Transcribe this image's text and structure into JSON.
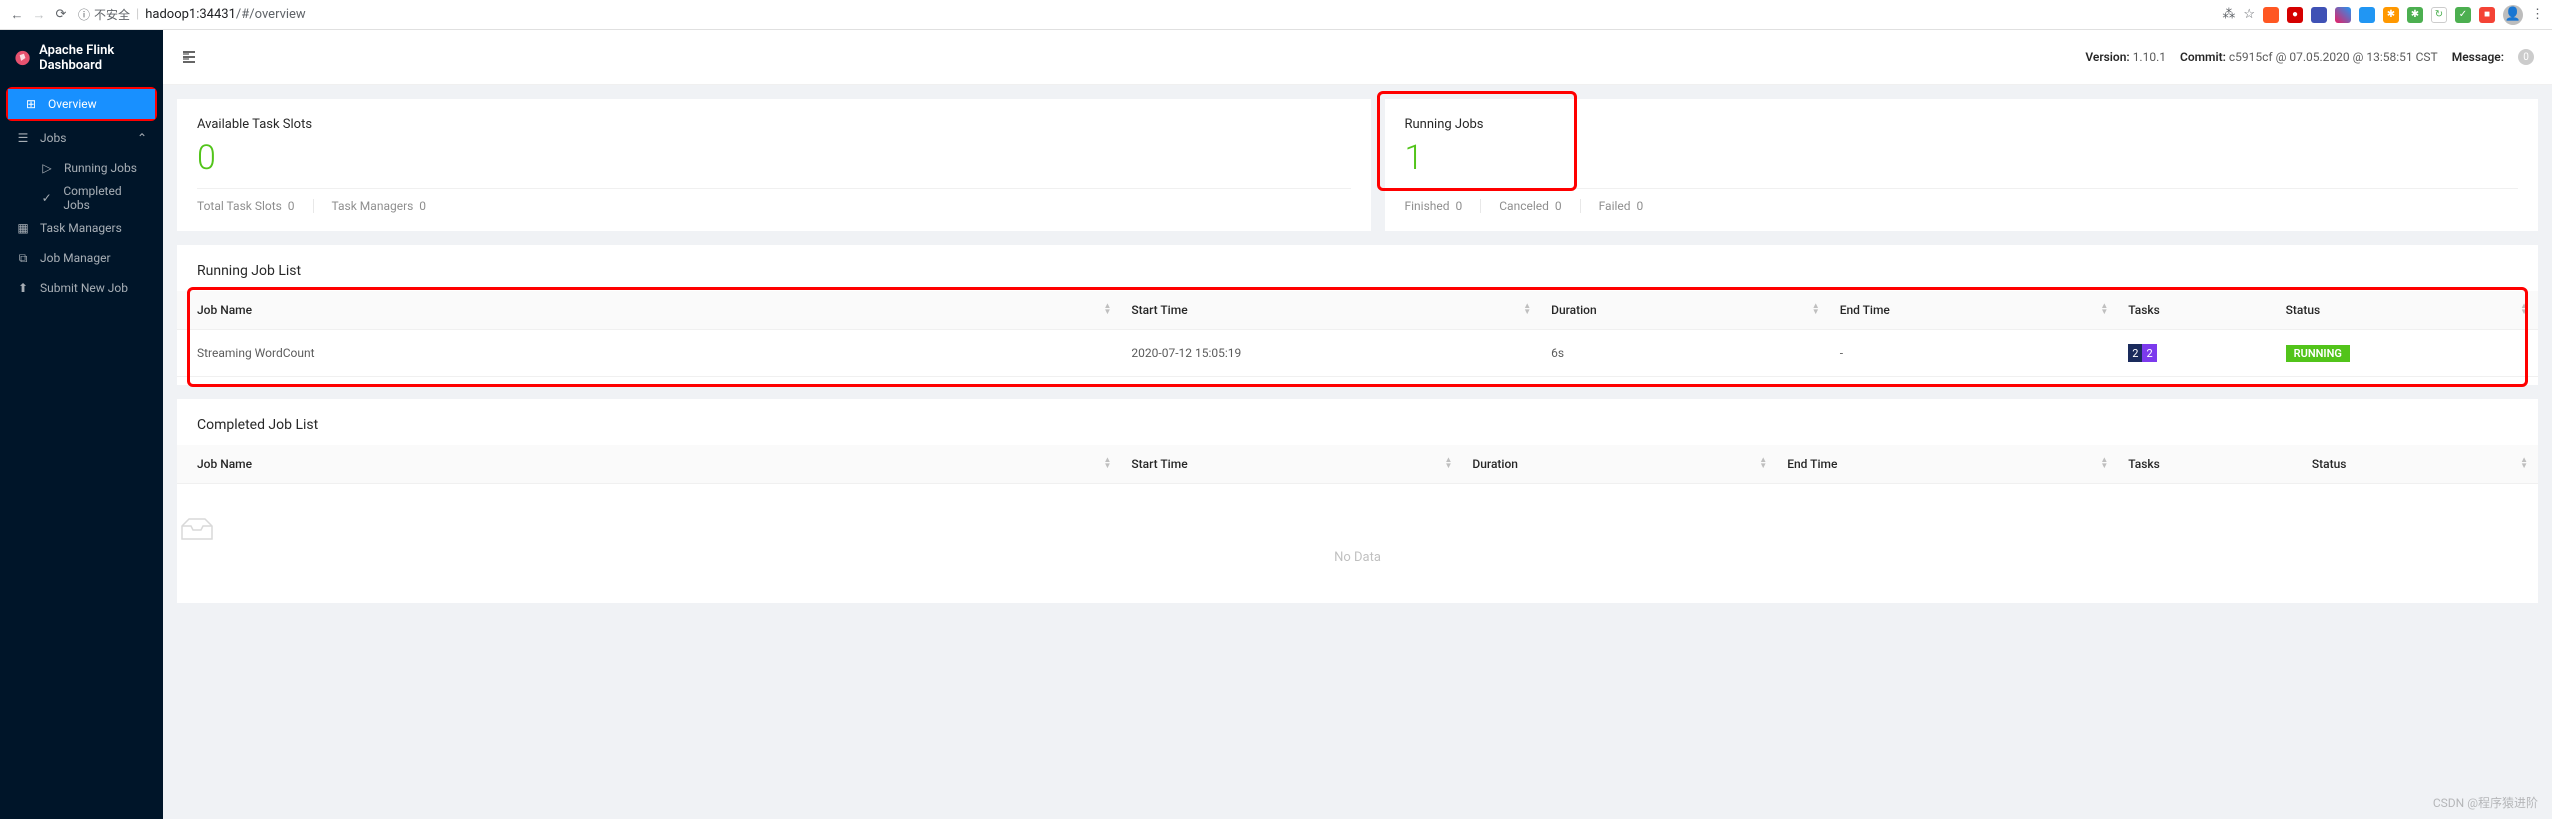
{
  "browser": {
    "url_security": "不安全",
    "url_host": "hadoop1:34431",
    "url_path": "/#/overview"
  },
  "brand": "Apache Flink Dashboard",
  "nav": {
    "overview": "Overview",
    "jobs": "Jobs",
    "running_jobs": "Running Jobs",
    "completed_jobs": "Completed Jobs",
    "task_managers": "Task Managers",
    "job_manager": "Job Manager",
    "submit_new_job": "Submit New Job"
  },
  "topbar": {
    "version_label": "Version:",
    "version_value": "1.10.1",
    "commit_label": "Commit:",
    "commit_value": "c5915cf @ 07.05.2020 @ 13:58:51 CST",
    "message_label": "Message:",
    "message_count": "0"
  },
  "stats": {
    "available_slots": {
      "title": "Available Task Slots",
      "value": "0",
      "total_slots_label": "Total Task Slots",
      "total_slots": "0",
      "tm_label": "Task Managers",
      "tm": "0"
    },
    "running_jobs": {
      "title": "Running Jobs",
      "value": "1",
      "finished_label": "Finished",
      "finished": "0",
      "canceled_label": "Canceled",
      "canceled": "0",
      "failed_label": "Failed",
      "failed": "0"
    }
  },
  "running_list": {
    "title": "Running Job List",
    "columns": {
      "job_name": "Job Name",
      "start_time": "Start Time",
      "duration": "Duration",
      "end_time": "End Time",
      "tasks": "Tasks",
      "status": "Status"
    },
    "rows": [
      {
        "job_name": "Streaming WordCount",
        "start_time": "2020-07-12 15:05:19",
        "duration": "6s",
        "end_time": "-",
        "task_a": "2",
        "task_b": "2",
        "status": "RUNNING"
      }
    ]
  },
  "completed_list": {
    "title": "Completed Job List",
    "columns": {
      "job_name": "Job Name",
      "start_time": "Start Time",
      "duration": "Duration",
      "end_time": "End Time",
      "tasks": "Tasks",
      "status": "Status"
    },
    "no_data": "No Data"
  },
  "watermark": "CSDN @程序猿进阶"
}
